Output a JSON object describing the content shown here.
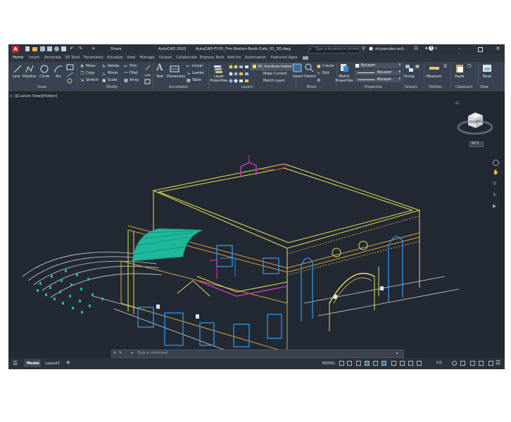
{
  "titlebar": {
    "app_letter": "A",
    "share": "Share",
    "app_version": "AutoCAD 2025",
    "filename": "AutoCAD-FY25_Fire-Station-Book-Cafe_01_3D.dwg",
    "search_placeholder": "Type a keyword or phrase",
    "username": "shiyamdev.onli..."
  },
  "ribbon_tabs": [
    "Home",
    "Insert",
    "Annotate",
    "3D Tools",
    "Parametric",
    "Visualize",
    "View",
    "Manage",
    "Output",
    "Collaborate",
    "Express Tools",
    "Add-ins",
    "Automation",
    "Featured Apps"
  ],
  "ribbon": {
    "draw": {
      "items": [
        "Line",
        "Polyline",
        "Circle",
        "Arc"
      ],
      "label": "Draw"
    },
    "modify": {
      "items": [
        "Move",
        "Rotate",
        "Trim",
        "Copy",
        "Mirror",
        "Fillet",
        "Stretch",
        "Scale",
        "Array"
      ],
      "label": "Modify"
    },
    "annotation": {
      "items": [
        "Text",
        "Dimension",
        "Linear",
        "Leader",
        "Table"
      ],
      "label": "Annotation"
    },
    "layers": {
      "big": "Layer Properties",
      "current": "3D_furniture-indoor",
      "make_current": "Make Current",
      "match_layer": "Match Layer",
      "label": "Layers"
    },
    "block": {
      "items": [
        "Insert",
        "Detect",
        "Create",
        "Edit"
      ],
      "label": "Block"
    },
    "properties": {
      "big": "Match Properties",
      "bylayer": [
        "ByLayer",
        "ByLayer",
        "ByLayer"
      ],
      "label": "Properties"
    },
    "groups": {
      "big": "Group",
      "label": "Groups"
    },
    "utilities": {
      "big": "Measure",
      "label": "Utilities"
    },
    "clipboard": {
      "big": "Paste",
      "label": "Clipboard"
    },
    "view": {
      "big": "Base",
      "label": "View"
    }
  },
  "viewport": {
    "label": "[−][Custom View][Hidden]",
    "wcs": "WCS",
    "cube_front": "FRONT",
    "cube_right": "RIGHT"
  },
  "command": {
    "placeholder": "Type a command"
  },
  "statusbar": {
    "tabs": [
      "Model",
      "Layout1"
    ],
    "add": "+",
    "model": "MODEL",
    "scale": "1/1"
  },
  "colors": {
    "line_yellow": "#e8e05a",
    "line_orange": "#d6a43c",
    "line_blue": "#2f8fe0",
    "line_teal": "#1fb89a",
    "line_magenta": "#d23ab6",
    "line_white": "#d9dde2",
    "bg": "#222933"
  }
}
